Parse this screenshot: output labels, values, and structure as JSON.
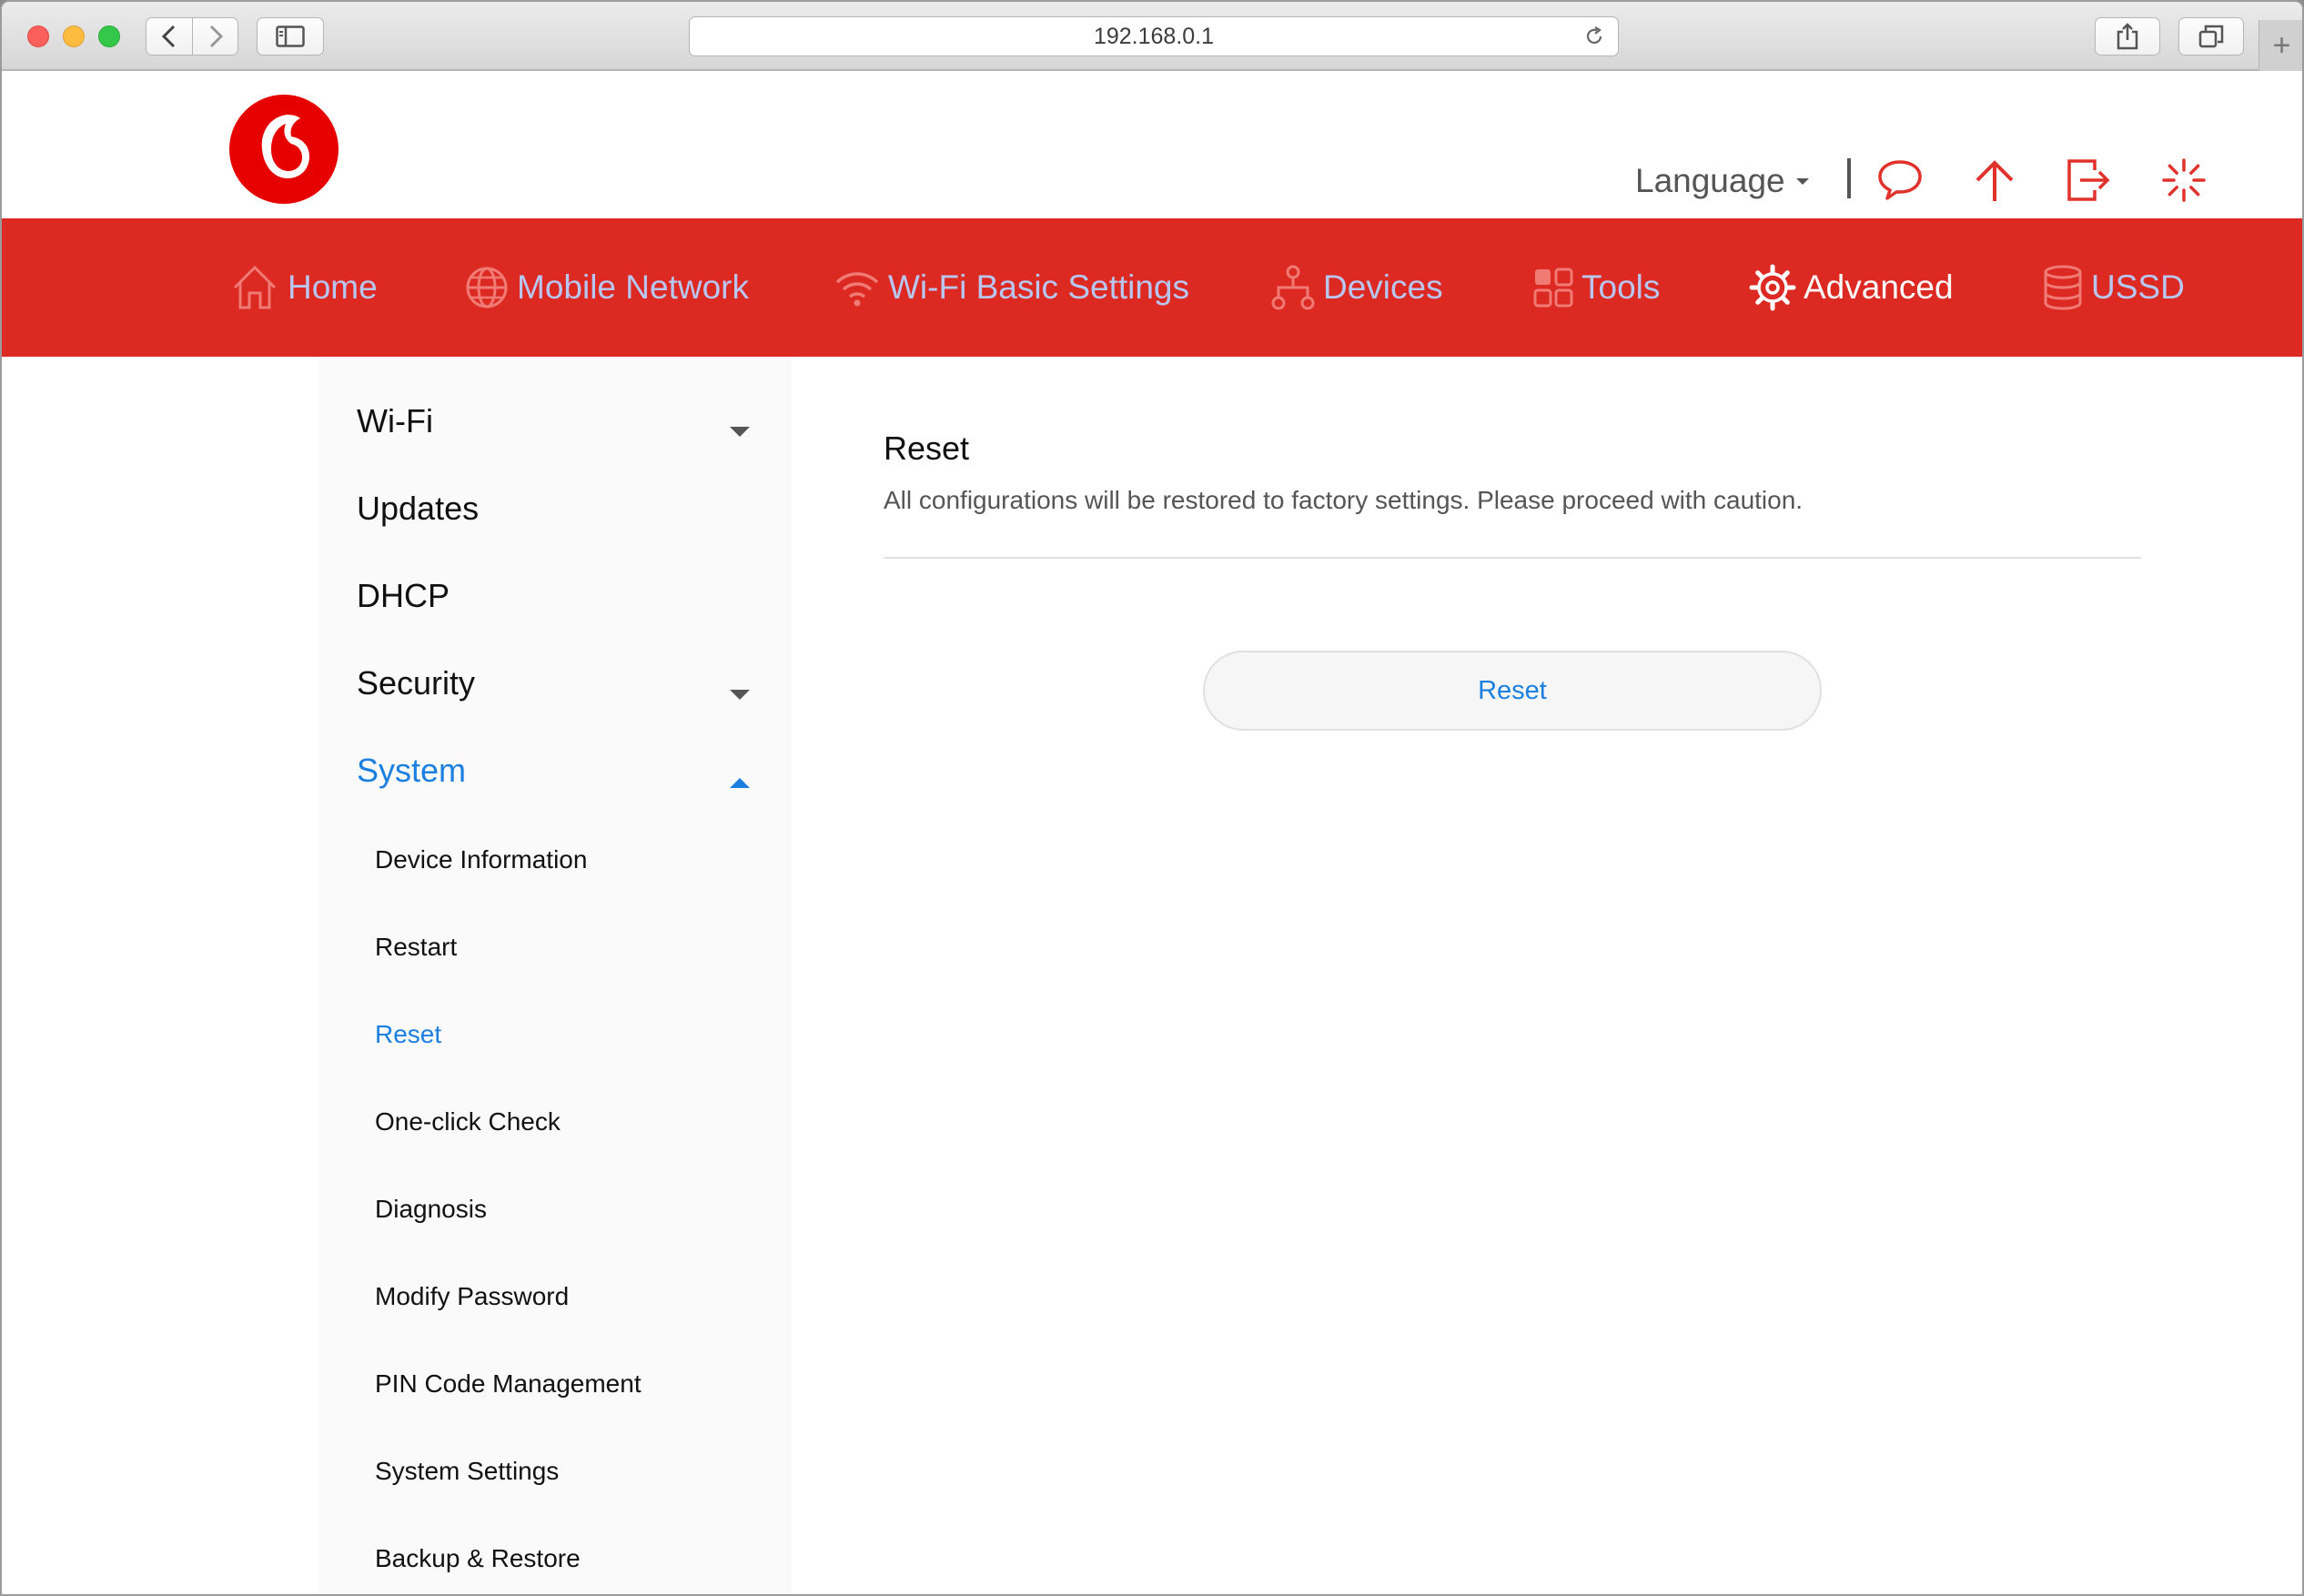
{
  "browser": {
    "url": "192.168.0.1",
    "new_tab_label": "+"
  },
  "header": {
    "language_label": "Language"
  },
  "nav": {
    "items": [
      {
        "label": "Home",
        "icon": "home-icon"
      },
      {
        "label": "Mobile Network",
        "icon": "globe-icon"
      },
      {
        "label": "Wi-Fi Basic Settings",
        "icon": "wifi-icon"
      },
      {
        "label": "Devices",
        "icon": "devices-icon"
      },
      {
        "label": "Tools",
        "icon": "tools-icon"
      },
      {
        "label": "Advanced",
        "icon": "gear-icon",
        "active": true
      },
      {
        "label": "USSD",
        "icon": "database-icon"
      }
    ]
  },
  "sidebar": {
    "sections": [
      {
        "label": "Wi-Fi",
        "expandable": true
      },
      {
        "label": "Updates"
      },
      {
        "label": "DHCP"
      },
      {
        "label": "Security",
        "expandable": true
      },
      {
        "label": "System",
        "expandable": true,
        "expanded": true,
        "active": true
      }
    ],
    "system_items": [
      {
        "label": "Device Information"
      },
      {
        "label": "Restart"
      },
      {
        "label": "Reset",
        "active": true
      },
      {
        "label": "One-click Check"
      },
      {
        "label": "Diagnosis"
      },
      {
        "label": "Modify Password"
      },
      {
        "label": "PIN Code Management"
      },
      {
        "label": "System Settings"
      },
      {
        "label": "Backup & Restore"
      }
    ]
  },
  "content": {
    "title": "Reset",
    "description": "All configurations will be restored to factory settings. Please proceed with caution.",
    "button_label": "Reset"
  },
  "colors": {
    "brand_red": "#dc2a22",
    "nav_text": "#b8c6f1",
    "link_blue": "#1a7fe0"
  }
}
